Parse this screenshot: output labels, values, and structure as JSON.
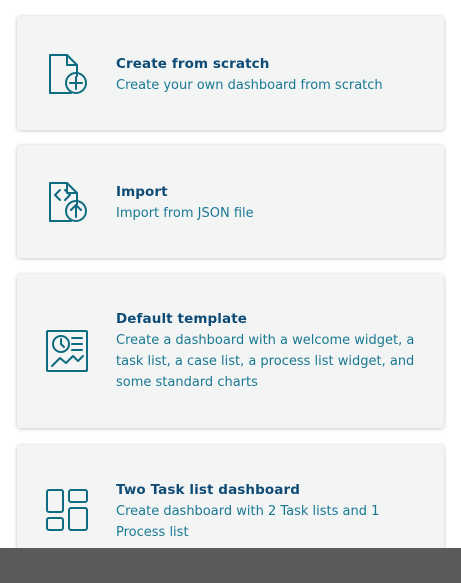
{
  "colors": {
    "card_background": "#f3f5f5",
    "title": "#0f4c75",
    "description": "#1a7893",
    "icon": "#0e6b80",
    "bottom_bar": "#5a5a5a"
  },
  "options": [
    {
      "title": "Create from scratch",
      "description": "Create your own dashboard from scratch",
      "icon": "file-plus-icon"
    },
    {
      "title": "Import",
      "description": "Import from JSON file",
      "icon": "file-code-upload-icon"
    },
    {
      "title": "Default template",
      "description": "Create a dashboard with a welcome widget, a task list, a case list, a process list widget, and some standard charts",
      "icon": "dashboard-report-icon"
    },
    {
      "title": "Two Task list dashboard",
      "description": "Create dashboard with 2 Task lists and 1 Process list",
      "icon": "layout-grid-icon"
    }
  ]
}
